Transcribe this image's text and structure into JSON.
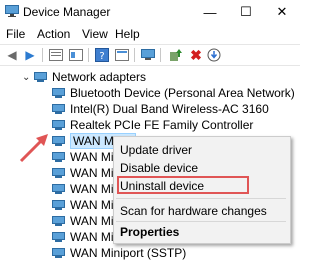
{
  "window": {
    "title": "Device Manager",
    "controls": {
      "minimize": "—",
      "maximize": "☐",
      "close": "✕"
    }
  },
  "menu": [
    "File",
    "Action",
    "View",
    "Help"
  ],
  "toolbar": {
    "buttons": [
      "back-icon",
      "forward-icon",
      "properties-icon",
      "show-hidden-icon",
      "help-icon",
      "resources-icon",
      "monitor-icon",
      "update-driver-icon",
      "uninstall-icon",
      "scan-icon"
    ]
  },
  "tree": {
    "category": "Network adapters",
    "items": [
      "Bluetooth Device (Personal Area Network)",
      "Intel(R) Dual Band Wireless-AC 3160",
      "Realtek PCIe FE Family Controller",
      "WAN Minip",
      "WAN Minip",
      "WAN Minip",
      "WAN Minip",
      "WAN Minip",
      "WAN Minip",
      "WAN Minip",
      "WAN Miniport (SSTP)"
    ],
    "selected_index": 3
  },
  "context_menu": {
    "items": [
      "Update driver",
      "Disable device",
      "Uninstall device",
      "Scan for hardware changes",
      "Properties"
    ],
    "highlighted": "Uninstall device"
  },
  "colors": {
    "highlight_box": "#e05555",
    "arrow": "#e05555",
    "selection": "#cce8ff"
  }
}
